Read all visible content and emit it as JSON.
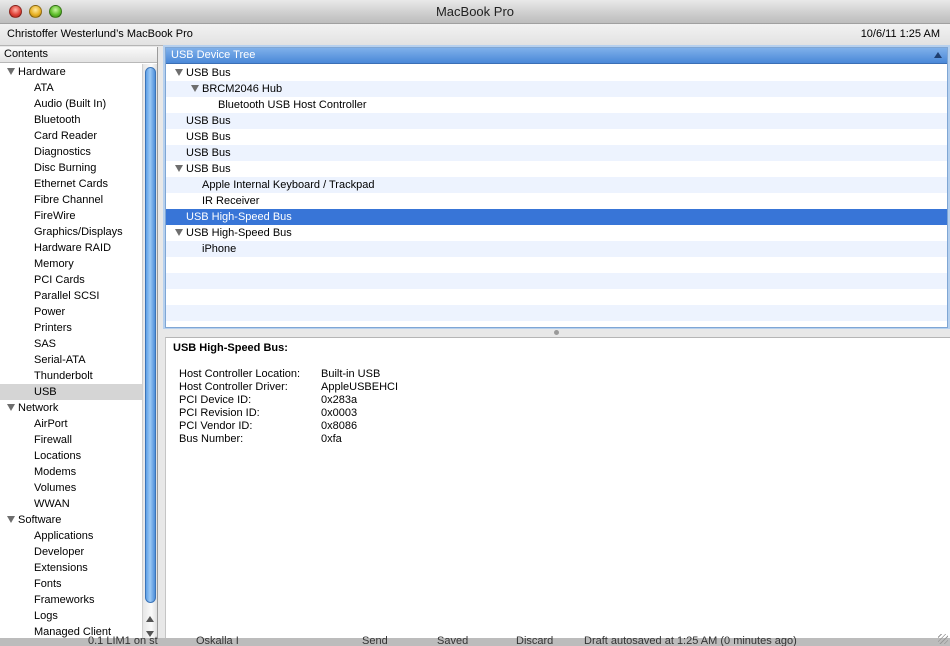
{
  "window": {
    "title": "MacBook Pro"
  },
  "header": {
    "machine_name": "Christoffer Westerlund’s MacBook Pro",
    "datetime": "10/6/11 1:25 AM"
  },
  "sidebar": {
    "header": "Contents",
    "rows": [
      {
        "label": "Hardware",
        "type": "category"
      },
      {
        "label": "ATA",
        "type": "item"
      },
      {
        "label": "Audio (Built In)",
        "type": "item"
      },
      {
        "label": "Bluetooth",
        "type": "item"
      },
      {
        "label": "Card Reader",
        "type": "item"
      },
      {
        "label": "Diagnostics",
        "type": "item"
      },
      {
        "label": "Disc Burning",
        "type": "item"
      },
      {
        "label": "Ethernet Cards",
        "type": "item"
      },
      {
        "label": "Fibre Channel",
        "type": "item"
      },
      {
        "label": "FireWire",
        "type": "item"
      },
      {
        "label": "Graphics/Displays",
        "type": "item"
      },
      {
        "label": "Hardware RAID",
        "type": "item"
      },
      {
        "label": "Memory",
        "type": "item"
      },
      {
        "label": "PCI Cards",
        "type": "item"
      },
      {
        "label": "Parallel SCSI",
        "type": "item"
      },
      {
        "label": "Power",
        "type": "item"
      },
      {
        "label": "Printers",
        "type": "item"
      },
      {
        "label": "SAS",
        "type": "item"
      },
      {
        "label": "Serial-ATA",
        "type": "item"
      },
      {
        "label": "Thunderbolt",
        "type": "item"
      },
      {
        "label": "USB",
        "type": "item",
        "selected": true
      },
      {
        "label": "Network",
        "type": "category"
      },
      {
        "label": "AirPort",
        "type": "item"
      },
      {
        "label": "Firewall",
        "type": "item"
      },
      {
        "label": "Locations",
        "type": "item"
      },
      {
        "label": "Modems",
        "type": "item"
      },
      {
        "label": "Volumes",
        "type": "item"
      },
      {
        "label": "WWAN",
        "type": "item"
      },
      {
        "label": "Software",
        "type": "category"
      },
      {
        "label": "Applications",
        "type": "item"
      },
      {
        "label": "Developer",
        "type": "item"
      },
      {
        "label": "Extensions",
        "type": "item"
      },
      {
        "label": "Fonts",
        "type": "item"
      },
      {
        "label": "Frameworks",
        "type": "item"
      },
      {
        "label": "Logs",
        "type": "item"
      },
      {
        "label": "Managed Client",
        "type": "item"
      }
    ]
  },
  "tree": {
    "header": "USB Device Tree",
    "rows": [
      {
        "label": "USB Bus",
        "level": 0,
        "expanded": true
      },
      {
        "label": "BRCM2046 Hub",
        "level": 1,
        "expanded": true
      },
      {
        "label": "Bluetooth USB Host Controller",
        "level": 2
      },
      {
        "label": "USB Bus",
        "level": 0
      },
      {
        "label": "USB Bus",
        "level": 0
      },
      {
        "label": "USB Bus",
        "level": 0
      },
      {
        "label": "USB Bus",
        "level": 0,
        "expanded": true
      },
      {
        "label": "Apple Internal Keyboard / Trackpad",
        "level": 1
      },
      {
        "label": "IR Receiver",
        "level": 1
      },
      {
        "label": "USB High-Speed Bus",
        "level": 0,
        "selected": true
      },
      {
        "label": "USB High-Speed Bus",
        "level": 0,
        "expanded": true
      },
      {
        "label": "iPhone",
        "level": 1
      },
      {
        "label": "",
        "level": 0
      },
      {
        "label": "",
        "level": 0
      },
      {
        "label": "",
        "level": 0
      },
      {
        "label": "",
        "level": 0
      }
    ]
  },
  "detail": {
    "title": "USB High-Speed Bus:",
    "properties": [
      {
        "key": "Host Controller Location:",
        "value": "Built-in USB"
      },
      {
        "key": "Host Controller Driver:",
        "value": "AppleUSBEHCI"
      },
      {
        "key": "PCI Device ID:",
        "value": "0x283a"
      },
      {
        "key": "PCI Revision ID:",
        "value": "0x0003"
      },
      {
        "key": "PCI Vendor ID:",
        "value": "0x8086"
      },
      {
        "key": "Bus Number:",
        "value": "0xfa"
      }
    ]
  },
  "background_window": {
    "texts": [
      "0.1 LIM1 on st",
      "Oskalla I",
      "Send",
      "Saved",
      "Discard",
      "Draft autosaved at 1:25 AM (0 minutes ago)"
    ]
  }
}
